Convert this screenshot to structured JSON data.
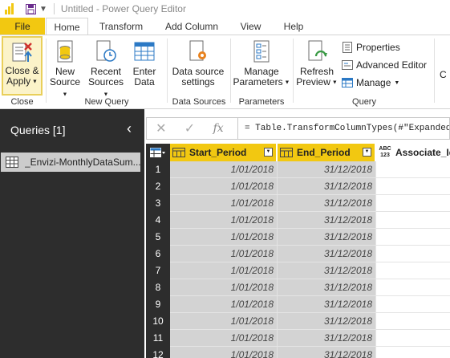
{
  "window": {
    "title": "Untitled - Power Query Editor"
  },
  "tabs": [
    {
      "label": "File"
    },
    {
      "label": "Home"
    },
    {
      "label": "Transform"
    },
    {
      "label": "Add Column"
    },
    {
      "label": "View"
    },
    {
      "label": "Help"
    }
  ],
  "ribbon": {
    "close_apply": {
      "line1": "Close &",
      "line2": "Apply"
    },
    "new_source": {
      "line1": "New",
      "line2": "Source"
    },
    "recent_sources": {
      "line1": "Recent",
      "line2": "Sources"
    },
    "enter_data": {
      "line1": "Enter",
      "line2": "Data"
    },
    "data_source_settings": {
      "line1": "Data source",
      "line2": "settings"
    },
    "manage_parameters": {
      "line1": "Manage",
      "line2": "Parameters"
    },
    "refresh_preview": {
      "line1": "Refresh",
      "line2": "Preview"
    },
    "properties": "Properties",
    "advanced_editor": "Advanced Editor",
    "manage": "Manage",
    "partial_next": "C",
    "groups": {
      "close": "Close",
      "new_query": "New Query",
      "data_sources": "Data Sources",
      "parameters": "Parameters",
      "query": "Query"
    }
  },
  "queries": {
    "title": "Queries [1]",
    "items": [
      {
        "name": "_Envizi-MonthlyDataSum..."
      }
    ]
  },
  "formula": "= Table.TransformColumnTypes(#\"Expanded",
  "table": {
    "columns": [
      {
        "name": "Start_Period",
        "type_icon": "calendar-icon"
      },
      {
        "name": "End_Period",
        "type_icon": "calendar-icon"
      },
      {
        "name": "Associate_Id",
        "type_icon": "any-type-icon",
        "type_text_top": "ABC",
        "type_text_bottom": "123"
      }
    ],
    "rows": [
      {
        "n": "1",
        "start": "1/01/2018",
        "end": "31/12/2018"
      },
      {
        "n": "2",
        "start": "1/01/2018",
        "end": "31/12/2018"
      },
      {
        "n": "3",
        "start": "1/01/2018",
        "end": "31/12/2018"
      },
      {
        "n": "4",
        "start": "1/01/2018",
        "end": "31/12/2018"
      },
      {
        "n": "5",
        "start": "1/01/2018",
        "end": "31/12/2018"
      },
      {
        "n": "6",
        "start": "1/01/2018",
        "end": "31/12/2018"
      },
      {
        "n": "7",
        "start": "1/01/2018",
        "end": "31/12/2018"
      },
      {
        "n": "8",
        "start": "1/01/2018",
        "end": "31/12/2018"
      },
      {
        "n": "9",
        "start": "1/01/2018",
        "end": "31/12/2018"
      },
      {
        "n": "10",
        "start": "1/01/2018",
        "end": "31/12/2018"
      },
      {
        "n": "11",
        "start": "1/01/2018",
        "end": "31/12/2018"
      },
      {
        "n": "12",
        "start": "1/01/2018",
        "end": "31/12/2018"
      }
    ]
  },
  "colors": {
    "accent": "#f2c811",
    "queries_pane": "#2d2d2d"
  }
}
